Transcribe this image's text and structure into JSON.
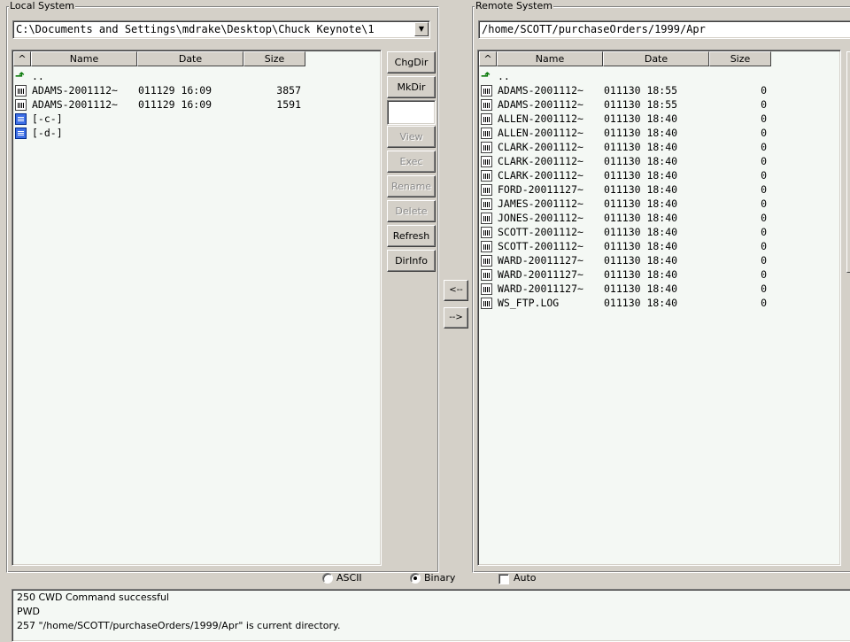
{
  "local": {
    "title": "Local System",
    "path": "C:\\Documents and Settings\\mdrake\\Desktop\\Chuck Keynote\\1",
    "columns": [
      "^",
      "Name",
      "Date",
      "Size"
    ],
    "up_label": "..",
    "files": [
      {
        "name": "ADAMS-2001112~",
        "date": "011129 16:09",
        "size": "3857"
      },
      {
        "name": "ADAMS-2001112~",
        "date": "011129 16:09",
        "size": "1591"
      }
    ],
    "drives": [
      "[-c-]",
      "[-d-]"
    ],
    "buttons": {
      "chgdir": "ChgDir",
      "mkdir": "MkDir",
      "view": "View",
      "exec": "Exec",
      "rename": "Rename",
      "delete": "Delete",
      "refresh": "Refresh",
      "dirinfo": "DirInfo"
    }
  },
  "transfer": {
    "to_local": "<--",
    "to_remote": "-->"
  },
  "remote": {
    "title": "Remote System",
    "path": "/home/SCOTT/purchaseOrders/1999/Apr",
    "columns": [
      "^",
      "Name",
      "Date",
      "Size"
    ],
    "up_label": "..",
    "files": [
      {
        "name": "ADAMS-2001112~",
        "date": "011130 18:55",
        "size": "0"
      },
      {
        "name": "ADAMS-2001112~",
        "date": "011130 18:55",
        "size": "0"
      },
      {
        "name": "ALLEN-2001112~",
        "date": "011130 18:40",
        "size": "0"
      },
      {
        "name": "ALLEN-2001112~",
        "date": "011130 18:40",
        "size": "0"
      },
      {
        "name": "CLARK-2001112~",
        "date": "011130 18:40",
        "size": "0"
      },
      {
        "name": "CLARK-2001112~",
        "date": "011130 18:40",
        "size": "0"
      },
      {
        "name": "CLARK-2001112~",
        "date": "011130 18:40",
        "size": "0"
      },
      {
        "name": "FORD-20011127~",
        "date": "011130 18:40",
        "size": "0"
      },
      {
        "name": "JAMES-2001112~",
        "date": "011130 18:40",
        "size": "0"
      },
      {
        "name": "JONES-2001112~",
        "date": "011130 18:40",
        "size": "0"
      },
      {
        "name": "SCOTT-2001112~",
        "date": "011130 18:40",
        "size": "0"
      },
      {
        "name": "SCOTT-2001112~",
        "date": "011130 18:40",
        "size": "0"
      },
      {
        "name": "WARD-20011127~",
        "date": "011130 18:40",
        "size": "0"
      },
      {
        "name": "WARD-20011127~",
        "date": "011130 18:40",
        "size": "0"
      },
      {
        "name": "WARD-20011127~",
        "date": "011130 18:40",
        "size": "0"
      },
      {
        "name": "WS_FTP.LOG",
        "date": "011130 18:40",
        "size": "0"
      }
    ]
  },
  "mode": {
    "ascii": "ASCII",
    "binary": "Binary",
    "auto": "Auto",
    "selected": "Binary",
    "auto_checked": false
  },
  "log": [
    "250 CWD Command successful",
    "PWD",
    "257 \"/home/SCOTT/purchaseOrders/1999/Apr\" is current directory."
  ]
}
